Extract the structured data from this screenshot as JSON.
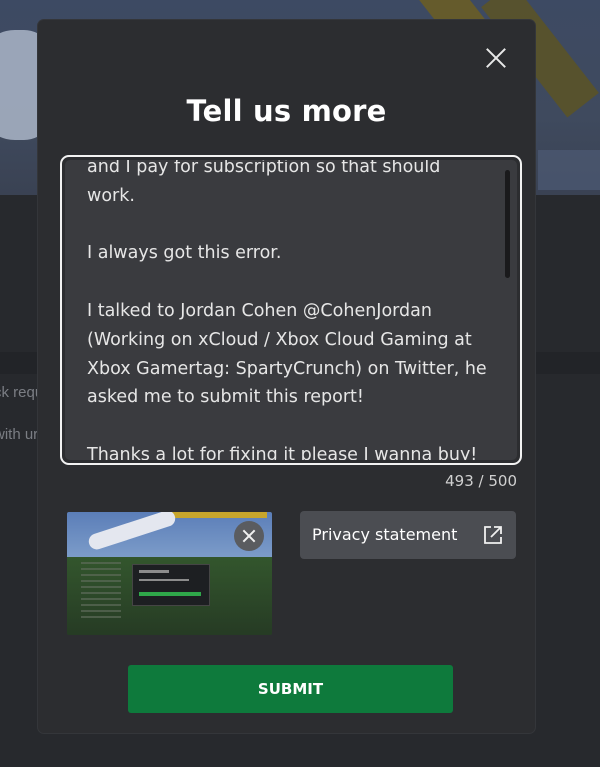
{
  "background": {
    "partial_text_1": "ck requ",
    "partial_text_2": "with ur"
  },
  "modal": {
    "title": "Tell us more",
    "feedback_text": "and I pay for subscription so that should work.\n\nI always got this error.\n\nI talked to Jordan Cohen @CohenJordan (Working on xCloud / Xbox Cloud Gaming at Xbox Gamertag: SpartyCrunch) on Twitter, he asked me to submit this report!\n\nThanks a lot for fixing it please I wanna buy!",
    "char_count": "493 / 500",
    "privacy_label": "Privacy statement",
    "submit_label": "SUBMIT",
    "icons": {
      "close": "close-icon",
      "remove_screenshot": "close-icon",
      "privacy_external": "external-link-icon"
    },
    "colors": {
      "submit_bg": "#0e7a3c",
      "modal_bg": "#2c2d30",
      "textarea_bg": "#3a3b3f"
    }
  }
}
